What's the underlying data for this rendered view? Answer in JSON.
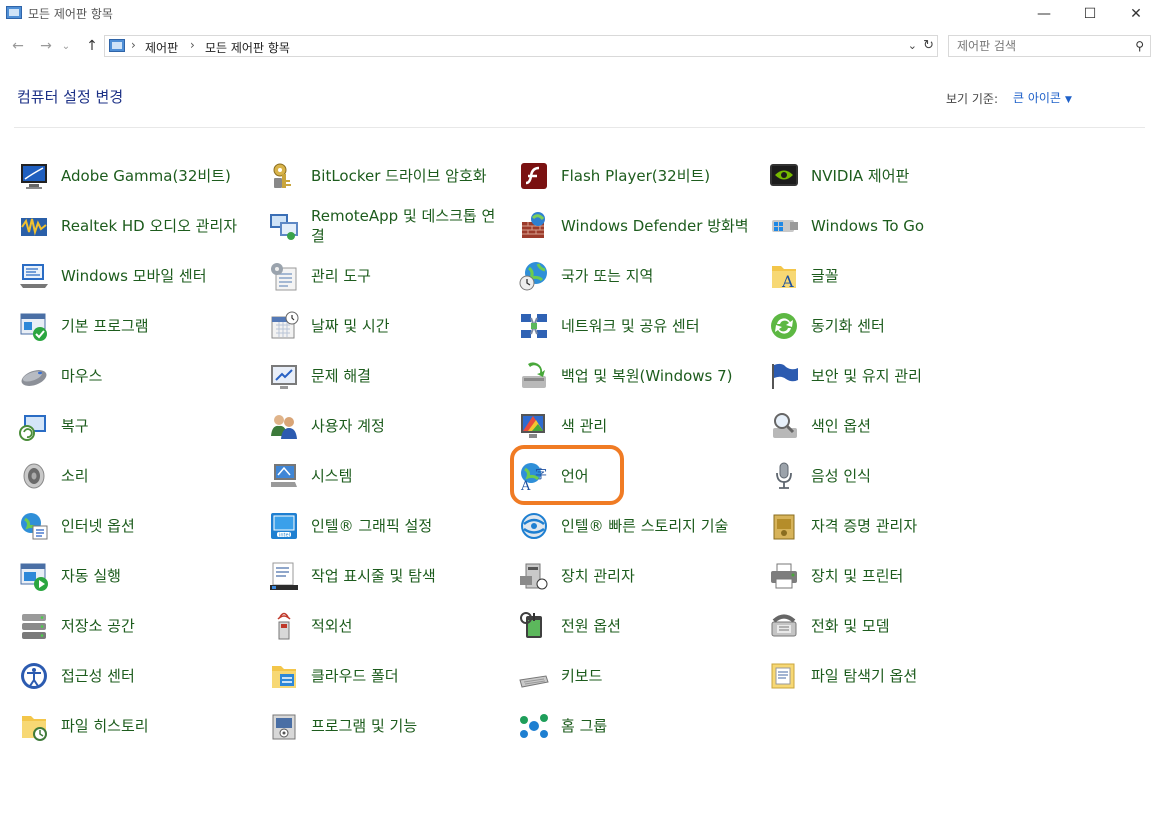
{
  "window": {
    "title": "모든 제어판 항목",
    "minimize": "—",
    "maximize": "☐",
    "close": "✕"
  },
  "nav": {
    "back": "←",
    "forward": "→",
    "history": "⌄",
    "up": "↑",
    "breadcrumb": [
      "제어판",
      "모든 제어판 항목"
    ],
    "search_placeholder": "제어판 검색"
  },
  "header": {
    "title": "컴퓨터 설정 변경",
    "view_by_label": "보기 기준:",
    "view_by_value": "큰 아이콘"
  },
  "items": [
    {
      "label": "Adobe Gamma(32비트)",
      "icon": "monitor-gamma-icon"
    },
    {
      "label": "BitLocker 드라이브 암호화",
      "icon": "bitlocker-key-icon"
    },
    {
      "label": "Flash Player(32비트)",
      "icon": "flash-player-icon"
    },
    {
      "label": "NVIDIA 제어판",
      "icon": "nvidia-icon"
    },
    {
      "label": "Realtek HD 오디오 관리자",
      "icon": "realtek-audio-icon"
    },
    {
      "label": "RemoteApp 및 데스크톱 연결",
      "icon": "remoteapp-icon"
    },
    {
      "label": "Windows Defender 방화벽",
      "icon": "firewall-icon"
    },
    {
      "label": "Windows To Go",
      "icon": "windows-to-go-icon"
    },
    {
      "label": "Windows 모바일 센터",
      "icon": "mobility-center-icon"
    },
    {
      "label": "관리 도구",
      "icon": "admin-tools-icon"
    },
    {
      "label": "국가 또는 지역",
      "icon": "region-globe-icon"
    },
    {
      "label": "글꼴",
      "icon": "fonts-folder-icon"
    },
    {
      "label": "기본 프로그램",
      "icon": "default-programs-icon"
    },
    {
      "label": "날짜 및 시간",
      "icon": "date-time-icon"
    },
    {
      "label": "네트워크 및 공유 센터",
      "icon": "network-icon"
    },
    {
      "label": "동기화 센터",
      "icon": "sync-center-icon"
    },
    {
      "label": "마우스",
      "icon": "mouse-icon"
    },
    {
      "label": "문제 해결",
      "icon": "troubleshooting-icon"
    },
    {
      "label": "백업 및 복원(Windows 7)",
      "icon": "backup-restore-icon"
    },
    {
      "label": "보안 및 유지 관리",
      "icon": "security-flag-icon"
    },
    {
      "label": "복구",
      "icon": "recovery-icon"
    },
    {
      "label": "사용자 계정",
      "icon": "user-accounts-icon"
    },
    {
      "label": "색 관리",
      "icon": "color-management-icon"
    },
    {
      "label": "색인 옵션",
      "icon": "indexing-icon"
    },
    {
      "label": "소리",
      "icon": "speaker-icon"
    },
    {
      "label": "시스템",
      "icon": "system-icon"
    },
    {
      "label": "언어",
      "icon": "language-icon"
    },
    {
      "label": "음성 인식",
      "icon": "microphone-icon"
    },
    {
      "label": "인터넷 옵션",
      "icon": "internet-options-icon"
    },
    {
      "label": "인텔® 그래픽 설정",
      "icon": "intel-graphics-icon"
    },
    {
      "label": "인텔® 빠른 스토리지 기술",
      "icon": "intel-storage-icon"
    },
    {
      "label": "자격 증명 관리자",
      "icon": "credential-manager-icon"
    },
    {
      "label": "자동 실행",
      "icon": "autoplay-icon"
    },
    {
      "label": "작업 표시줄 및 탐색",
      "icon": "taskbar-icon"
    },
    {
      "label": "장치 관리자",
      "icon": "device-manager-icon"
    },
    {
      "label": "장치 및 프린터",
      "icon": "printer-icon"
    },
    {
      "label": "저장소 공간",
      "icon": "storage-spaces-icon"
    },
    {
      "label": "적외선",
      "icon": "infrared-icon"
    },
    {
      "label": "전원 옵션",
      "icon": "power-options-icon"
    },
    {
      "label": "전화 및 모뎀",
      "icon": "phone-modem-icon"
    },
    {
      "label": "접근성 센터",
      "icon": "ease-of-access-icon"
    },
    {
      "label": "클라우드 폴더",
      "icon": "work-folders-icon"
    },
    {
      "label": "키보드",
      "icon": "keyboard-icon"
    },
    {
      "label": "파일 탐색기 옵션",
      "icon": "folder-options-icon"
    },
    {
      "label": "파일 히스토리",
      "icon": "file-history-icon"
    },
    {
      "label": "프로그램 및 기능",
      "icon": "programs-features-icon"
    },
    {
      "label": "홈 그룹",
      "icon": "homegroup-icon"
    }
  ],
  "highlighted_item": "언어",
  "colors": {
    "link_text": "#1d5c1d",
    "heading": "#1e3287",
    "view_value": "#1f61c9",
    "highlight_border": "#f07b24"
  }
}
